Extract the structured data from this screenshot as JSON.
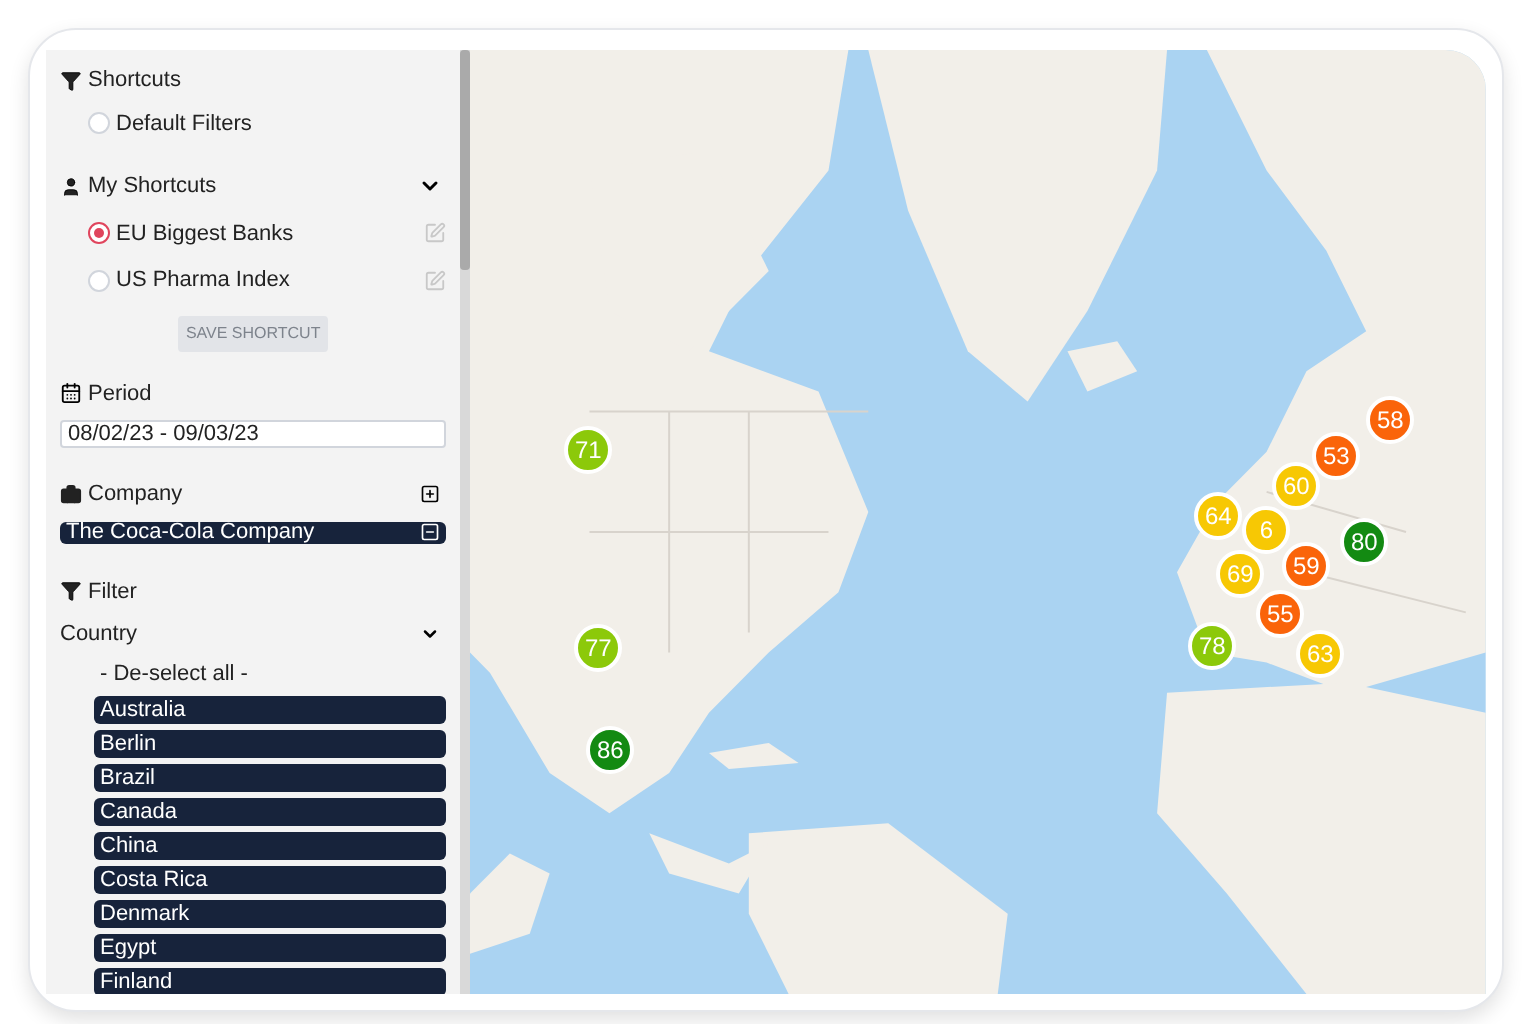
{
  "shortcuts": {
    "title": "Shortcuts",
    "items": [
      {
        "label": "Default Filters",
        "selected": false
      }
    ]
  },
  "my_shortcuts": {
    "title": "My Shortcuts",
    "expanded": true,
    "items": [
      {
        "label": "EU Biggest Banks",
        "selected": true
      },
      {
        "label": "US Pharma Index",
        "selected": false
      }
    ]
  },
  "save_button": {
    "label": "SAVE SHORTCUT",
    "disabled": true
  },
  "period": {
    "label": "Period",
    "value": "08/02/23 - 09/03/23"
  },
  "company": {
    "label": "Company",
    "selected_items": [
      "The Coca-Cola Company"
    ]
  },
  "filter": {
    "title": "Filter",
    "country": {
      "label": "Country",
      "expanded": true,
      "deselect_label": "- De-select all -",
      "items": [
        "Australia",
        "Berlin",
        "Brazil",
        "Canada",
        "China",
        "Costa Rica",
        "Denmark",
        "Egypt",
        "Finland"
      ]
    }
  },
  "map": {
    "markers": [
      {
        "label": "71",
        "color": "#8cc90a"
      },
      {
        "label": "77",
        "color": "#8cc90a"
      },
      {
        "label": "86",
        "color": "#138a12"
      },
      {
        "label": "58",
        "color": "#fa640a"
      },
      {
        "label": "53",
        "color": "#fa640a"
      },
      {
        "label": "60",
        "color": "#f7c804"
      },
      {
        "label": "64",
        "color": "#f7c804"
      },
      {
        "label": "6",
        "color": "#f7c804"
      },
      {
        "label": "69",
        "color": "#f7c804"
      },
      {
        "label": "59",
        "color": "#fa640a"
      },
      {
        "label": "55",
        "color": "#fa640a"
      },
      {
        "label": "80",
        "color": "#138a12"
      },
      {
        "label": "63",
        "color": "#f7c804"
      },
      {
        "label": "78",
        "color": "#8cc90a"
      }
    ]
  }
}
